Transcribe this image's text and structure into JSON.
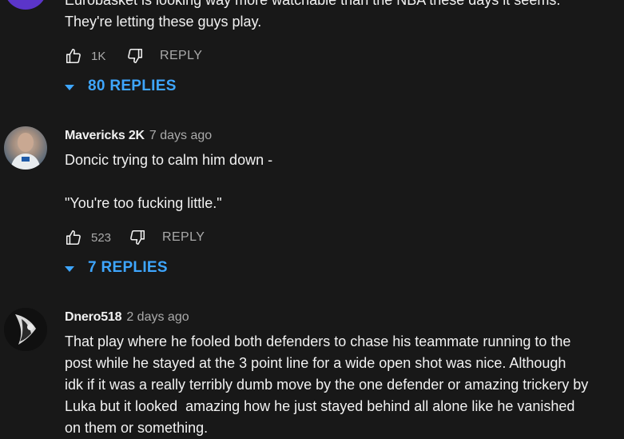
{
  "comments": [
    {
      "text_lines": [
        "Eurobasket is looking way more watchable than the NBA these days it seems.",
        "They're letting these guys play."
      ],
      "likes": "1K",
      "reply_label": "REPLY",
      "replies_label": "80 REPLIES",
      "avatar_color": "#5b35c9"
    },
    {
      "author": "Mavericks 2K",
      "time": "7 days ago",
      "text_lines": [
        "Doncic trying to calm him down -",
        "",
        "\"You're too fucking little.\""
      ],
      "likes": "523",
      "reply_label": "REPLY",
      "replies_label": "7 REPLIES"
    },
    {
      "author": "Dnero518",
      "time": "2 days ago",
      "text_lines": [
        "That play where he fooled both defenders to chase his teammate running to the",
        "post while he stayed at the 3 point line for a wide open shot was nice. Although",
        "idk if it was a really terribly dumb move by the one defender or amazing trickery by",
        "Luka but it looked  amazing how he just stayed behind all alone like he vanished",
        "on them or something."
      ]
    }
  ],
  "colors": {
    "background": "#181818",
    "link": "#3ea6ff",
    "secondary": "#aaaaaa",
    "text": "#f1f1f1"
  },
  "icons": {
    "like": "thumbs-up-icon",
    "dislike": "thumbs-down-icon",
    "expand": "caret-down-icon"
  }
}
